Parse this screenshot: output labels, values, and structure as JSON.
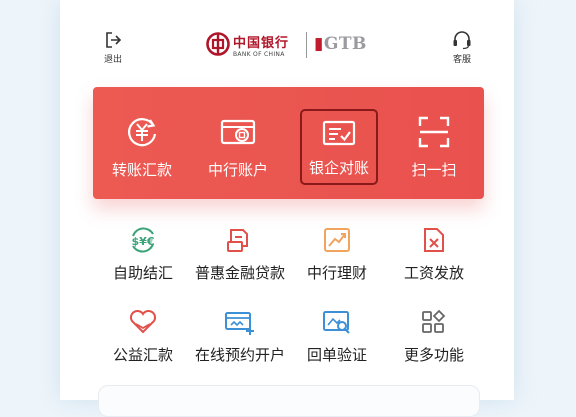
{
  "header": {
    "logout_label": "退出",
    "service_label": "客服",
    "bank_name_cn": "中国银行",
    "bank_name_en": "BANK OF CHINA",
    "gtb_text": "GTB",
    "icons": [
      "logout-icon",
      "headset-icon"
    ]
  },
  "banner": {
    "background": "#ea554f",
    "items": [
      {
        "label": "转账汇款",
        "icon": "yuan-transfer-icon",
        "selected": false
      },
      {
        "label": "中行账户",
        "icon": "account-card-icon",
        "selected": false
      },
      {
        "label": "银企对账",
        "icon": "reconcile-icon",
        "selected": true
      },
      {
        "label": "扫一扫",
        "icon": "scan-icon",
        "selected": false
      }
    ]
  },
  "grid": {
    "items": [
      {
        "label": "自助结汇",
        "icon": "fx-exchange-icon",
        "color": "#3aa37a"
      },
      {
        "label": "普惠金融贷款",
        "icon": "loan-icon",
        "color": "#e2504a"
      },
      {
        "label": "中行理财",
        "icon": "wealth-chart-icon",
        "color": "#f2a45e"
      },
      {
        "label": "工资发放",
        "icon": "salary-doc-icon",
        "color": "#e2504a"
      },
      {
        "label": "公益汇款",
        "icon": "charity-heart-icon",
        "color": "#e2504a"
      },
      {
        "label": "在线预约开户",
        "icon": "online-booking-icon",
        "color": "#3d8fd6"
      },
      {
        "label": "回单验证",
        "icon": "receipt-verify-icon",
        "color": "#3d8fd6"
      },
      {
        "label": "更多功能",
        "icon": "more-grid-icon",
        "color": "#666666"
      }
    ]
  }
}
